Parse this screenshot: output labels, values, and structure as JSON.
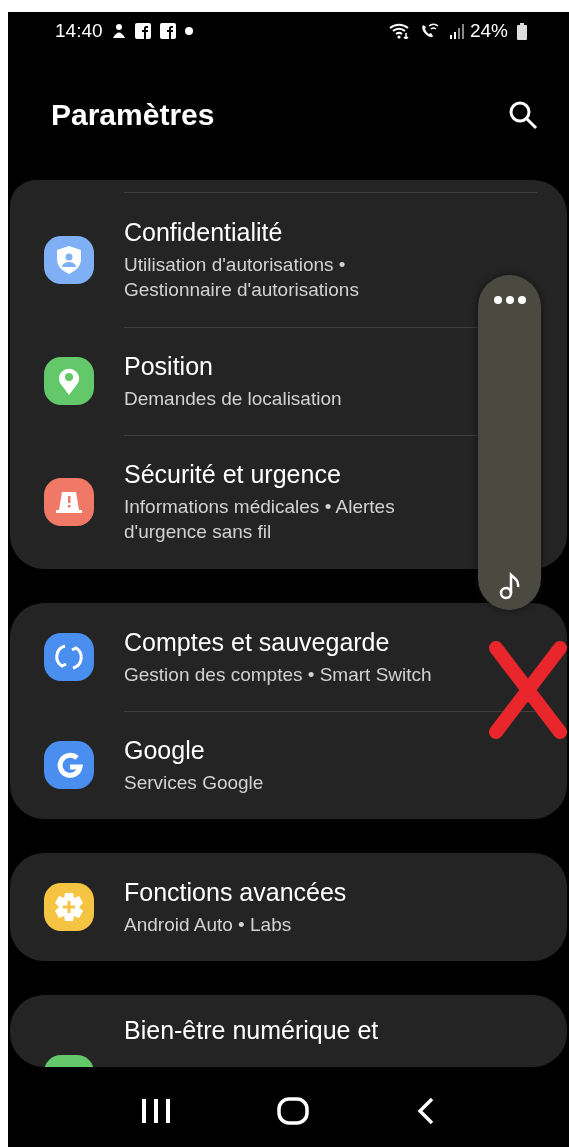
{
  "status_bar": {
    "time": "14:40",
    "battery": "24%"
  },
  "header": {
    "title": "Paramètres"
  },
  "sections": [
    {
      "items": [
        {
          "title": "Confidentialité",
          "subtitle": "Utilisation d'autorisations • Gestionnaire d'autorisations",
          "color": "#7fb0f5"
        },
        {
          "title": "Position",
          "subtitle": "Demandes de localisation",
          "color": "#62c86a"
        },
        {
          "title": "Sécurité et urgence",
          "subtitle": "Informations médicales • Alertes d'urgence sans fil",
          "color": "#f07866"
        }
      ]
    },
    {
      "items": [
        {
          "title": "Comptes et sauvegarde",
          "subtitle": "Gestion des comptes • Smart Switch",
          "color": "#4a8ef0"
        },
        {
          "title": "Google",
          "subtitle": "Services Google",
          "color": "#4a8ef0"
        }
      ]
    },
    {
      "items": [
        {
          "title": "Fonctions avancées",
          "subtitle": "Android Auto • Labs",
          "color": "#f5c443"
        }
      ]
    },
    {
      "items": [
        {
          "title": "Bien-être numérique et",
          "color": "#62c86a"
        }
      ]
    }
  ]
}
